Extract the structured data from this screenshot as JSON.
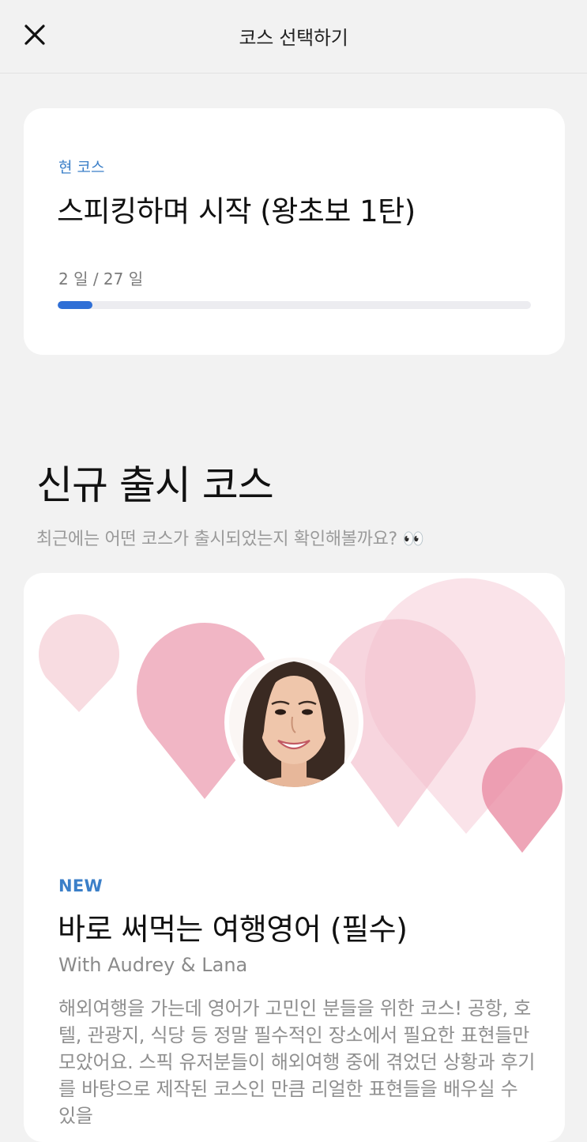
{
  "header": {
    "title": "코스 선택하기",
    "close_icon": "close-icon"
  },
  "current_course": {
    "label": "현 코스",
    "title": "스피킹하며 시작 (왕초보 1탄)",
    "progress_text": "2 일 / 27 일",
    "progress_fraction": 0.074,
    "accent_color": "#2f6fd6"
  },
  "new_courses_section": {
    "title": "신규 출시 코스",
    "subtitle": "최근에는 어떤 코스가 출시되었는지 확인해볼까요? 👀"
  },
  "featured_course": {
    "badge": "NEW",
    "title": "바로 써먹는 여행영어 (필수)",
    "instructors": "With Audrey & Lana",
    "description": "해외여행을 가는데 영어가 고민인 분들을 위한 코스! 공항, 호텔, 관광지, 식당 등 정말 필수적인 장소에서 필요한 표현들만 모았어요. 스픽 유저분들이 해외여행 중에 겪었던 상황과 후기를 바탕으로 제작된 코스인 만큼 리얼한 표현들을 배우실 수 있을",
    "banner_color": "#ee9fb5",
    "avatar": "instructor-avatar"
  }
}
